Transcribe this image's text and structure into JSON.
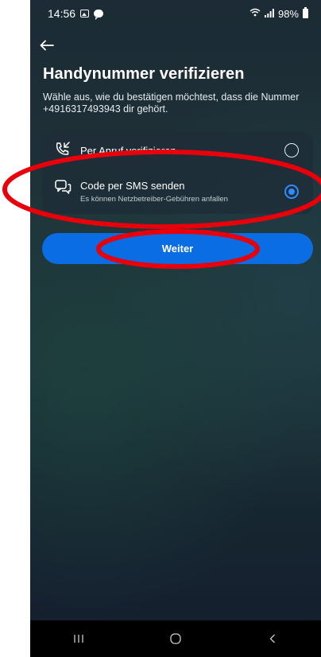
{
  "status_bar": {
    "time": "14:56",
    "battery": "98%",
    "icons": [
      "gallery-icon",
      "chat-icon",
      "wifi-icon",
      "signal-icon",
      "battery-icon"
    ]
  },
  "header": {
    "back_icon": "arrow-left-icon",
    "title": "Handynummer verifizieren",
    "subtitle": "Wähle aus, wie du bestätigen möchtest, dass die Nummer +4916317493943 dir gehört."
  },
  "options": [
    {
      "label": "Per Anruf verifizieren",
      "sublabel": "",
      "icon": "phone-call-icon",
      "selected": false
    },
    {
      "label": "Code per SMS senden",
      "sublabel": "Es können Netzbetreiber-Gebühren anfallen",
      "icon": "chat-bubbles-icon",
      "selected": true
    }
  ],
  "primary_button": {
    "label": "Weiter"
  },
  "colors": {
    "accent": "#0a6de3",
    "radio_selected": "#2f8bff",
    "annotation": "#e8000a"
  },
  "nav_bar": {
    "icons": [
      "recents-icon",
      "home-icon",
      "back-icon"
    ]
  }
}
